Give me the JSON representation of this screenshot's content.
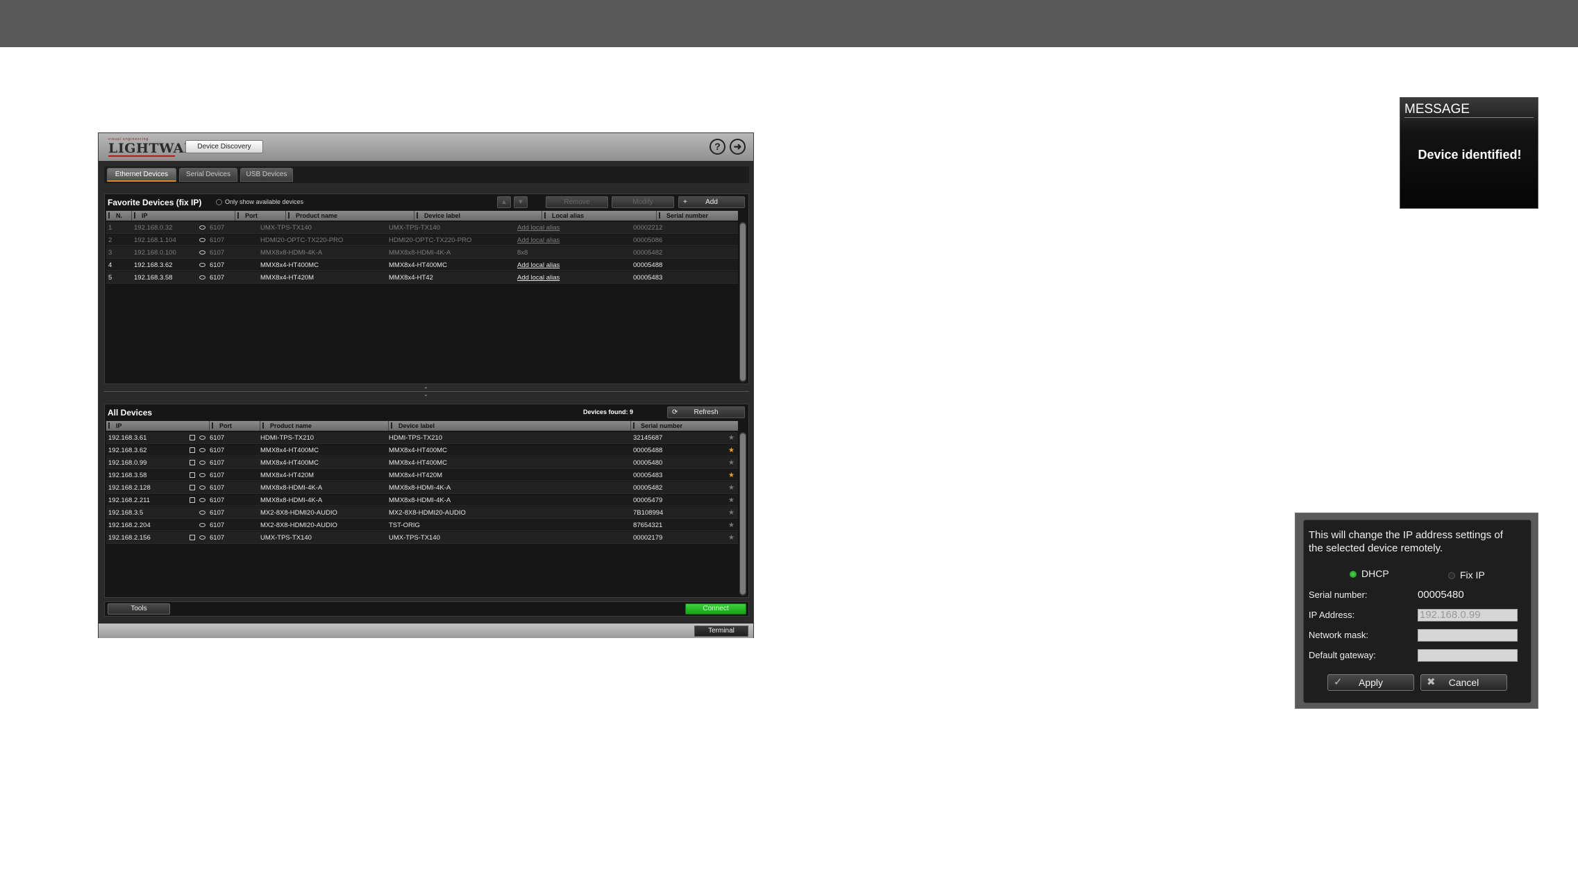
{
  "app": {
    "logo_top": "visual engineering",
    "logo_main": "LIGHTWARE",
    "discovery_button": "Device Discovery",
    "help_icon": "question-circle-icon",
    "exit_icon": "logout-icon",
    "tabs": [
      {
        "label": "Ethernet Devices",
        "active": true
      },
      {
        "label": "Serial Devices",
        "active": false
      },
      {
        "label": "USB Devices",
        "active": false
      }
    ],
    "favorites": {
      "title": "Favorite Devices (fix IP)",
      "only_available_label": "Only show available devices",
      "toolbar": {
        "remove_label": "Remove",
        "modify_label": "Modify",
        "add_label": "Add"
      },
      "columns": [
        "N.",
        "IP",
        "Port",
        "Product name",
        "Device label",
        "Local alias",
        "Serial number"
      ],
      "rows": [
        {
          "n": "1",
          "ip": "192.168.0.32",
          "port": "6107",
          "product": "UMX-TPS-TX140",
          "label": "UMX-TPS-TX140",
          "alias": "Add local alias",
          "serial": "00002212",
          "available": false
        },
        {
          "n": "2",
          "ip": "192.168.1.104",
          "port": "6107",
          "product": "HDMI20-OPTC-TX220-PRO",
          "label": "HDMI20-OPTC-TX220-PRO",
          "alias": "Add local alias",
          "serial": "00005086",
          "available": false
        },
        {
          "n": "3",
          "ip": "192.168.0.100",
          "port": "6107",
          "product": "MMX8x8-HDMI-4K-A",
          "label": "MMX8x8-HDMI-4K-A",
          "alias": "8x8",
          "serial": "00005482",
          "available": false
        },
        {
          "n": "4",
          "ip": "192.168.3.62",
          "port": "6107",
          "product": "MMX8x4-HT400MC",
          "label": "MMX8x4-HT400MC",
          "alias": "Add local alias",
          "serial": "00005488",
          "available": true
        },
        {
          "n": "5",
          "ip": "192.168.3.58",
          "port": "6107",
          "product": "MMX8x4-HT420M",
          "label": "MMX8x4-HT42",
          "alias": "Add local alias",
          "serial": "00005483",
          "available": true
        }
      ]
    },
    "all_devices": {
      "title": "All Devices",
      "found_label": "Devices found: 9",
      "refresh_label": "Refresh",
      "columns": [
        "IP",
        "Port",
        "Product name",
        "Device label",
        "Serial number"
      ],
      "rows": [
        {
          "ip": "192.168.3.61",
          "port": "6107",
          "product": "HDMI-TPS-TX210",
          "label": "HDMI-TPS-TX210",
          "serial": "32145687",
          "editable": true,
          "favorite": false
        },
        {
          "ip": "192.168.3.62",
          "port": "6107",
          "product": "MMX8x4-HT400MC",
          "label": "MMX8x4-HT400MC",
          "serial": "00005488",
          "editable": true,
          "favorite": true
        },
        {
          "ip": "192.168.0.99",
          "port": "6107",
          "product": "MMX8x4-HT400MC",
          "label": "MMX8x4-HT400MC",
          "serial": "00005480",
          "editable": true,
          "favorite": false
        },
        {
          "ip": "192.168.3.58",
          "port": "6107",
          "product": "MMX8x4-HT420M",
          "label": "MMX8x4-HT420M",
          "serial": "00005483",
          "editable": true,
          "favorite": true
        },
        {
          "ip": "192.168.2.128",
          "port": "6107",
          "product": "MMX8x8-HDMI-4K-A",
          "label": "MMX8x8-HDMI-4K-A",
          "serial": "00005482",
          "editable": true,
          "favorite": false
        },
        {
          "ip": "192.168.2.211",
          "port": "6107",
          "product": "MMX8x8-HDMI-4K-A",
          "label": "MMX8x8-HDMI-4K-A",
          "serial": "00005479",
          "editable": true,
          "favorite": false
        },
        {
          "ip": "192.168.3.5",
          "port": "6107",
          "product": "MX2-8X8-HDMI20-AUDIO",
          "label": "MX2-8X8-HDMI20-AUDIO",
          "serial": "7B108994",
          "editable": false,
          "favorite": false
        },
        {
          "ip": "192.168.2.204",
          "port": "6107",
          "product": "MX2-8X8-HDMI20-AUDIO",
          "label": "TST-ORIG",
          "serial": "87654321",
          "editable": false,
          "favorite": false
        },
        {
          "ip": "192.168.2.156",
          "port": "6107",
          "product": "UMX-TPS-TX140",
          "label": "UMX-TPS-TX140",
          "serial": "00002179",
          "editable": true,
          "favorite": false
        }
      ]
    },
    "tools_label": "Tools",
    "connect_label": "Connect",
    "terminal_label": "Terminal",
    "colors": {
      "accent": "#e08a1e",
      "connect": "#22b522",
      "favorite_star": "#f0a020"
    }
  },
  "message": {
    "title": "MESSAGE",
    "text": "Device identified!"
  },
  "ip_dialog": {
    "note": "This will change the IP address settings of the selected device remotely.",
    "dhcp_label": "DHCP",
    "fixip_label": "Fix IP",
    "dhcp_selected": true,
    "serial_label": "Serial number:",
    "serial_value": "00005480",
    "ip_label": "IP Address:",
    "ip_value": "192.168.0.99",
    "mask_label": "Network mask:",
    "mask_value": "",
    "gateway_label": "Default gateway:",
    "gateway_value": "",
    "apply_label": "Apply",
    "cancel_label": "Cancel"
  }
}
